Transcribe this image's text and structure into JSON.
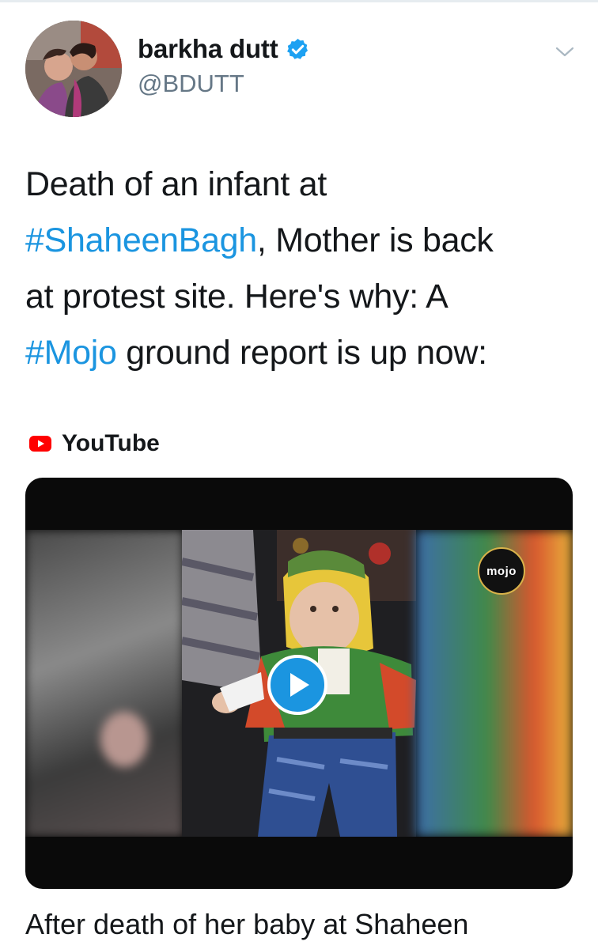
{
  "author": {
    "display_name": "barkha dutt",
    "handle": "@BDUTT",
    "verified": true,
    "avatar": "avatar"
  },
  "tweet": {
    "line1": "Death of an infant at",
    "hashtag1": "#ShaheenBagh",
    "line2_rest": ", Mother is back",
    "line3": "at protest site. Here's why: A",
    "hashtag2": "#Mojo",
    "line4_rest": " ground report is up now:"
  },
  "card": {
    "source_icon": "youtube-icon",
    "source_label": "YouTube",
    "channel_badge": "mojo",
    "play_icon": "play-icon",
    "title": "After death of her baby at Shaheen"
  },
  "icons": {
    "menu": "chevron-down-icon",
    "verified": "verified-badge-icon"
  },
  "colors": {
    "hashtag": "#1b95e0",
    "verified": "#1da1f2",
    "youtube": "#ff0000",
    "handle": "#657786"
  }
}
